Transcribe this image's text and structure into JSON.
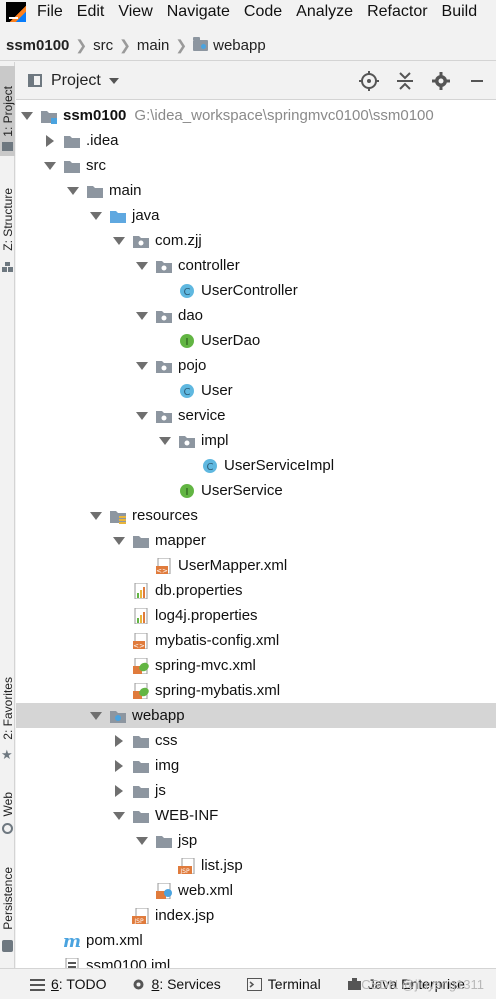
{
  "menu": [
    "File",
    "Edit",
    "View",
    "Navigate",
    "Code",
    "Analyze",
    "Refactor",
    "Build"
  ],
  "breadcrumb": [
    "ssm0100",
    "src",
    "main",
    "webapp"
  ],
  "left_tabs": [
    "1: Project",
    "Z: Structure",
    "2: Favorites",
    "Web",
    "Persistence"
  ],
  "panel": {
    "title": "Project"
  },
  "tree": [
    {
      "label": "ssm0100",
      "path": "G:\\idea_workspace\\springmvc0100\\ssm0100",
      "depth": 0,
      "arrow": "down",
      "icon": "module-folder-icon",
      "bold": true
    },
    {
      "label": ".idea",
      "depth": 1,
      "arrow": "right",
      "icon": "folder-icon"
    },
    {
      "label": "src",
      "depth": 1,
      "arrow": "down",
      "icon": "folder-icon"
    },
    {
      "label": "main",
      "depth": 2,
      "arrow": "down",
      "icon": "folder-icon"
    },
    {
      "label": "java",
      "depth": 3,
      "arrow": "down",
      "icon": "source-folder-icon"
    },
    {
      "label": "com.zjj",
      "depth": 4,
      "arrow": "down",
      "icon": "package-icon"
    },
    {
      "label": "controller",
      "depth": 5,
      "arrow": "down",
      "icon": "package-icon"
    },
    {
      "label": "UserController",
      "depth": 6,
      "arrow": "none",
      "icon": "class-icon"
    },
    {
      "label": "dao",
      "depth": 5,
      "arrow": "down",
      "icon": "package-icon"
    },
    {
      "label": "UserDao",
      "depth": 6,
      "arrow": "none",
      "icon": "interface-icon"
    },
    {
      "label": "pojo",
      "depth": 5,
      "arrow": "down",
      "icon": "package-icon"
    },
    {
      "label": "User",
      "depth": 6,
      "arrow": "none",
      "icon": "class-icon"
    },
    {
      "label": "service",
      "depth": 5,
      "arrow": "down",
      "icon": "package-icon"
    },
    {
      "label": "impl",
      "depth": 6,
      "arrow": "down",
      "icon": "package-icon"
    },
    {
      "label": "UserServiceImpl",
      "depth": 7,
      "arrow": "none",
      "icon": "class-icon"
    },
    {
      "label": "UserService",
      "depth": 6,
      "arrow": "none",
      "icon": "interface-icon"
    },
    {
      "label": "resources",
      "depth": 3,
      "arrow": "down",
      "icon": "resources-folder-icon"
    },
    {
      "label": "mapper",
      "depth": 4,
      "arrow": "down",
      "icon": "folder-icon"
    },
    {
      "label": "UserMapper.xml",
      "depth": 5,
      "arrow": "none",
      "icon": "xml-file-icon"
    },
    {
      "label": "db.properties",
      "depth": 4,
      "arrow": "none",
      "icon": "properties-file-icon"
    },
    {
      "label": "log4j.properties",
      "depth": 4,
      "arrow": "none",
      "icon": "properties-file-icon"
    },
    {
      "label": "mybatis-config.xml",
      "depth": 4,
      "arrow": "none",
      "icon": "xml-file-icon"
    },
    {
      "label": "spring-mvc.xml",
      "depth": 4,
      "arrow": "none",
      "icon": "spring-xml-icon"
    },
    {
      "label": "spring-mybatis.xml",
      "depth": 4,
      "arrow": "none",
      "icon": "spring-xml-icon"
    },
    {
      "label": "webapp",
      "depth": 3,
      "arrow": "down",
      "icon": "web-folder-icon",
      "selected": true
    },
    {
      "label": "css",
      "depth": 4,
      "arrow": "right",
      "icon": "folder-icon"
    },
    {
      "label": "img",
      "depth": 4,
      "arrow": "right",
      "icon": "folder-icon"
    },
    {
      "label": "js",
      "depth": 4,
      "arrow": "right",
      "icon": "folder-icon"
    },
    {
      "label": "WEB-INF",
      "depth": 4,
      "arrow": "down",
      "icon": "folder-icon"
    },
    {
      "label": "jsp",
      "depth": 5,
      "arrow": "down",
      "icon": "folder-icon"
    },
    {
      "label": "list.jsp",
      "depth": 6,
      "arrow": "none",
      "icon": "jsp-file-icon"
    },
    {
      "label": "web.xml",
      "depth": 5,
      "arrow": "none",
      "icon": "web-xml-icon"
    },
    {
      "label": "index.jsp",
      "depth": 4,
      "arrow": "none",
      "icon": "jsp-file-icon"
    },
    {
      "label": "pom.xml",
      "depth": 1,
      "arrow": "none",
      "icon": "maven-icon"
    },
    {
      "label": "ssm0100.iml",
      "depth": 1,
      "arrow": "none",
      "icon": "iml-file-icon"
    }
  ],
  "bottom_tabs": [
    {
      "num": "6",
      "label": ": TODO",
      "icon": "todo-list-icon"
    },
    {
      "num": "8",
      "label": ": Services",
      "icon": "services-icon"
    },
    {
      "num": "",
      "label": "Terminal",
      "icon": "terminal-icon"
    },
    {
      "num": "",
      "label": "Java Enterprise",
      "icon": "java-enterprise-icon"
    }
  ],
  "watermark": "CSDN @jiuyang1311",
  "colors": {
    "selected_row": "#d5d5d5",
    "class_icon": "#5fb8e0",
    "interface_icon": "#62b543",
    "jsp_badge": "#e07b3c"
  }
}
